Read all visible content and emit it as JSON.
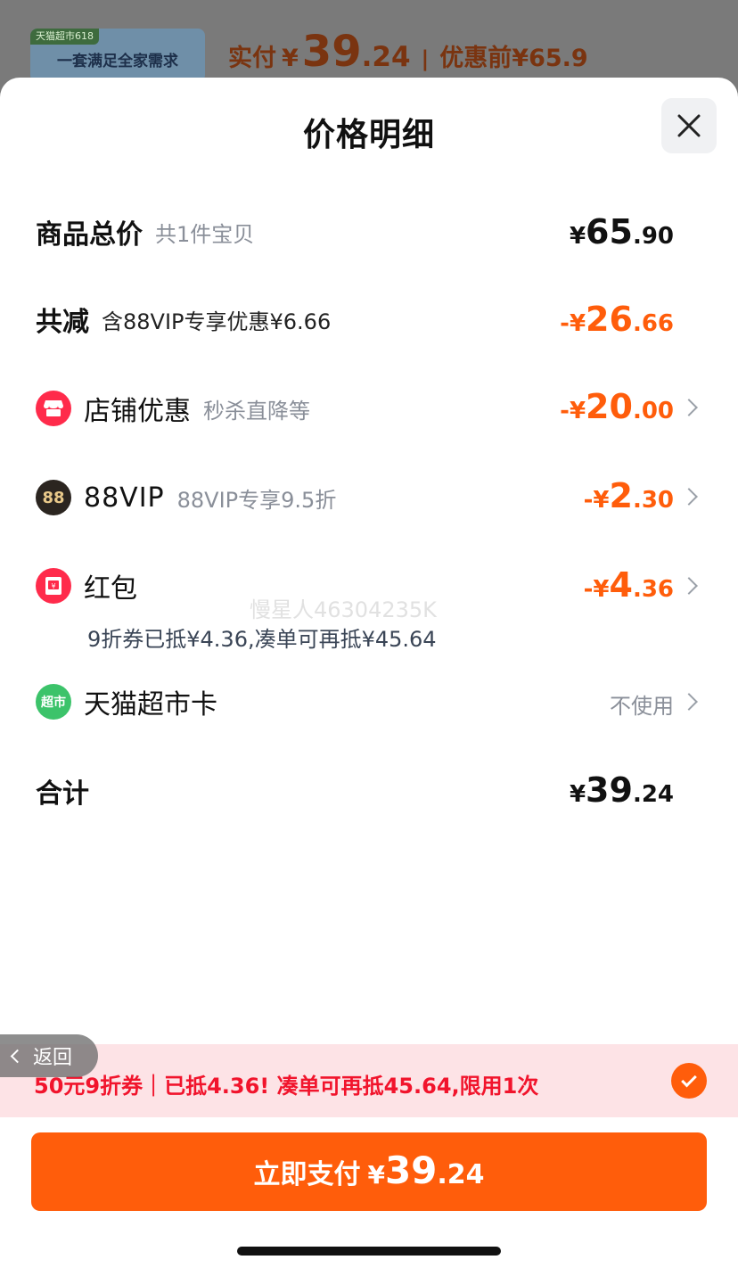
{
  "background": {
    "banner_tag": "天猫超市618",
    "banner_text": "一套满足全家需求",
    "actual_label": "实付",
    "actual_yen": "¥",
    "actual_int": "39",
    "actual_dec": ".24",
    "sep": "|",
    "before_discount": "优惠前¥65.9"
  },
  "sheet": {
    "title": "价格明细",
    "close_icon": "close-icon"
  },
  "rows": {
    "total": {
      "label": "商品总价",
      "sub": "共1件宝贝",
      "yen": "¥",
      "int": "65",
      "dec": ".90"
    },
    "reduce": {
      "label": "共减",
      "sub": "含88VIP专享优惠¥6.66",
      "yen": "-¥",
      "int": "26",
      "dec": ".66"
    },
    "shop": {
      "label": "店铺优惠",
      "sub": "秒杀直降等",
      "yen": "-¥",
      "int": "20",
      "dec": ".00",
      "icon": "shop-icon"
    },
    "vip": {
      "label": "88VIP",
      "sub": "88VIP专享9.5折",
      "yen": "-¥",
      "int": "2",
      "dec": ".30",
      "icon_text": "88"
    },
    "redpacket": {
      "label": "红包",
      "yen": "-¥",
      "int": "4",
      "dec": ".36",
      "note": "9折券已抵¥4.36,凑单可再抵¥45.64",
      "icon": "red-packet-icon"
    },
    "card": {
      "label": "天猫超市卡",
      "value": "不使用",
      "icon_text": "超市"
    },
    "sum": {
      "label": "合计",
      "yen": "¥",
      "int": "39",
      "dec": ".24"
    }
  },
  "watermark": "慢星人46304235K",
  "coupon_bar": {
    "text": "50元9折券｜已抵4.36! 凑单可再抵45.64,限用1次",
    "checked": true
  },
  "back": {
    "label": "返回"
  },
  "pay": {
    "label": "立即支付",
    "yen": "¥",
    "int": "39",
    "dec": ".24"
  },
  "colors": {
    "accent": "#ff5d0b",
    "bar_bg": "#fde3e6",
    "bar_text": "#f1142c"
  }
}
